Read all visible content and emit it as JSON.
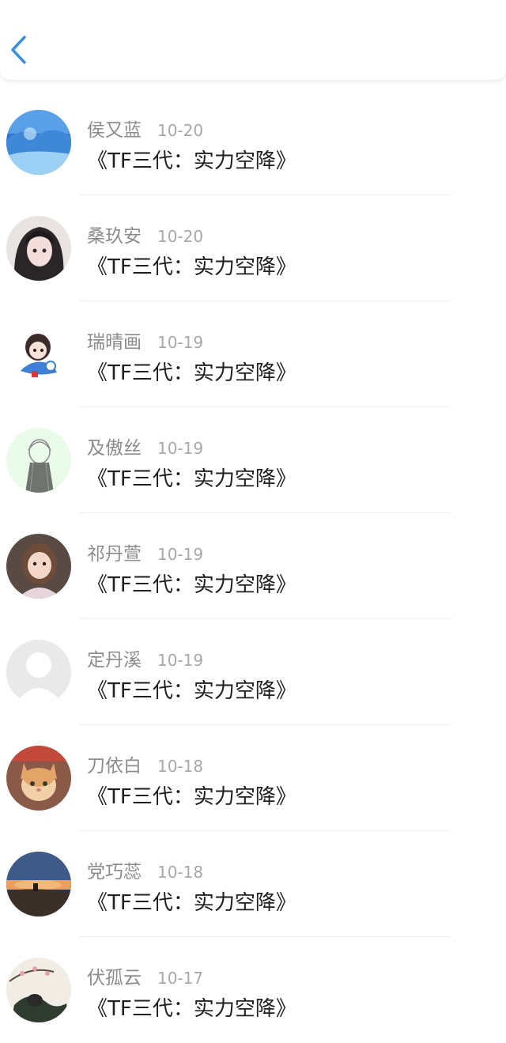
{
  "header": {
    "back_icon": "chevron-left-icon",
    "accent": "#3b8fe0"
  },
  "comments": [
    {
      "username": "侯又蓝",
      "date": "10-20",
      "text": "《TF三代：实力空降》",
      "avatar": "blue-landscape-avatar"
    },
    {
      "username": "桑玖安",
      "date": "10-20",
      "text": "《TF三代：实力空降》",
      "avatar": "anime-girl-dark-avatar"
    },
    {
      "username": "瑞晴画",
      "date": "10-19",
      "text": "《TF三代：实力空降》",
      "avatar": "chibi-character-avatar"
    },
    {
      "username": "及傲丝",
      "date": "10-19",
      "text": "《TF三代：实力空降》",
      "avatar": "sketch-girl-avatar"
    },
    {
      "username": "祁丹萱",
      "date": "10-19",
      "text": "《TF三代：实力空降》",
      "avatar": "child-photo-avatar"
    },
    {
      "username": "定丹溪",
      "date": "10-19",
      "text": "《TF三代：实力空降》",
      "avatar": "default-user-avatar"
    },
    {
      "username": "刀依白",
      "date": "10-18",
      "text": "《TF三代：实力空降》",
      "avatar": "cat-photo-avatar"
    },
    {
      "username": "党巧蕊",
      "date": "10-18",
      "text": "《TF三代：实力空降》",
      "avatar": "sunset-landscape-avatar"
    },
    {
      "username": "伏孤云",
      "date": "10-17",
      "text": "《TF三代：实力空降》",
      "avatar": "ink-painting-avatar"
    }
  ]
}
